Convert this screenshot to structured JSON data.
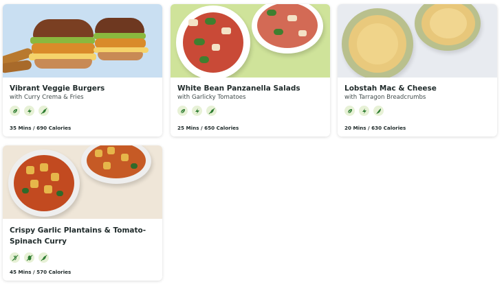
{
  "recipes": [
    {
      "title": "Vibrant Veggie Burgers",
      "subtitle": "with Curry Crema & Fries",
      "meta": "35 Mins / 690 Calories",
      "tags": [
        "vegan-icon",
        "quick-icon",
        "dairy-free-icon"
      ]
    },
    {
      "title": "White Bean Panzanella Salads",
      "subtitle": "with Garlicky Tomatoes",
      "meta": "25 Mins / 650 Calories",
      "tags": [
        "vegan-icon",
        "quick-icon",
        "dairy-free-icon"
      ]
    },
    {
      "title": "Lobstah Mac & Cheese",
      "subtitle": "with Tarragon Breadcrumbs",
      "meta": "20 Mins / 630 Calories",
      "tags": [
        "vegan-icon",
        "quick-icon",
        "pescatarian-icon"
      ]
    },
    {
      "title": "Crispy Garlic Plantains & Tomato-Spinach Curry",
      "subtitle": "",
      "meta": "45 Mins / 570 Calories",
      "tags": [
        "gluten-free-icon",
        "nut-free-icon",
        "dairy-free-icon"
      ]
    }
  ],
  "colors": {
    "tag_bg": "#e7f1d6",
    "tag_fg": "#2f7d32",
    "burger_bg": "#c9dff2",
    "salad_bg": "#cfe39a",
    "mac_bg": "#e8ebf0",
    "curry_bg": "#efe6d8"
  }
}
